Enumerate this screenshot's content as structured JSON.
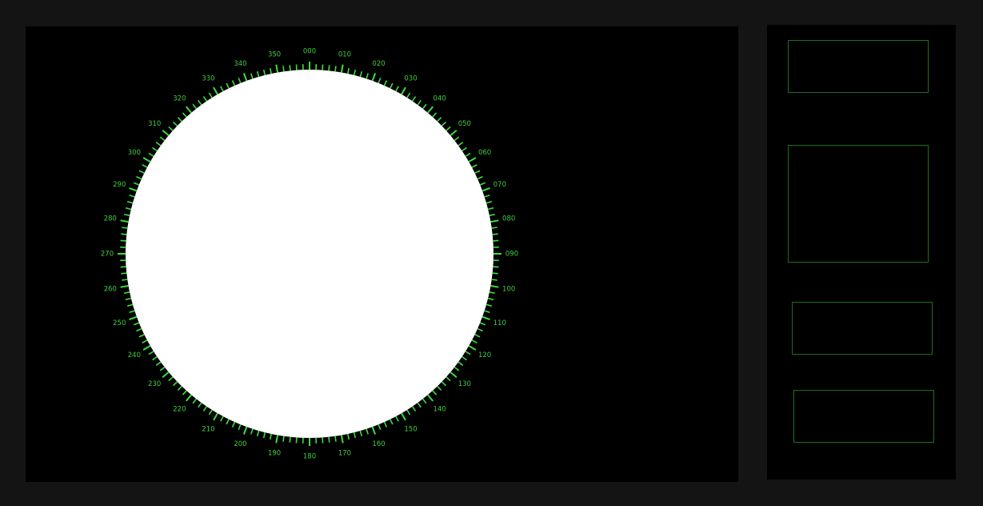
{
  "radar": {
    "bearing_labels": [
      "000",
      "010",
      "020",
      "030",
      "040",
      "050",
      "060",
      "070",
      "080",
      "090",
      "100",
      "110",
      "120",
      "130",
      "140",
      "150",
      "160",
      "170",
      "180",
      "190",
      "200",
      "210",
      "220",
      "230",
      "240",
      "250",
      "260",
      "270",
      "280",
      "290",
      "300",
      "310",
      "320",
      "330",
      "340",
      "350"
    ],
    "colors": {
      "scope_fill": "#ffffff",
      "tick": "#3be03b",
      "label": "#3fcf3f",
      "background": "#000000"
    }
  },
  "side_panel": {
    "boxes": [
      {
        "name": "info-box-1",
        "text": ""
      },
      {
        "name": "info-box-2",
        "text": ""
      },
      {
        "name": "info-box-3",
        "text": ""
      },
      {
        "name": "info-box-4",
        "text": ""
      }
    ],
    "border_color": "#1f6d1f"
  }
}
